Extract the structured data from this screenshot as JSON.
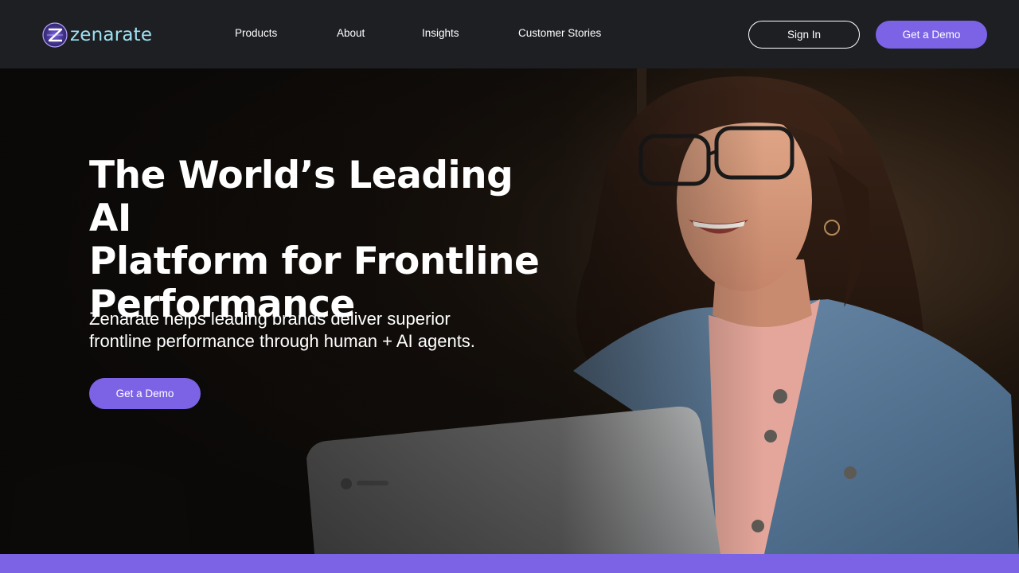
{
  "brand": {
    "name": "zenarate",
    "logo_icon": "z-circle-logo-icon",
    "accent": "#7c63e6",
    "logo_color": "#9fe0f2"
  },
  "nav": {
    "links": [
      {
        "label": "Products"
      },
      {
        "label": "About"
      },
      {
        "label": "Insights"
      },
      {
        "label": "Customer Stories"
      }
    ],
    "sign_in": "Sign In",
    "get_demo": "Get a Demo"
  },
  "hero": {
    "title_lines": [
      "The World’s Leading AI",
      "Platform for Frontline",
      "Performance"
    ],
    "subtitle_lines": [
      "Zenarate helps leading brands deliver superior",
      "frontline performance through human + AI agents."
    ],
    "cta": "Get a Demo",
    "photo": "woman-smiling-with-laptop-photo"
  }
}
